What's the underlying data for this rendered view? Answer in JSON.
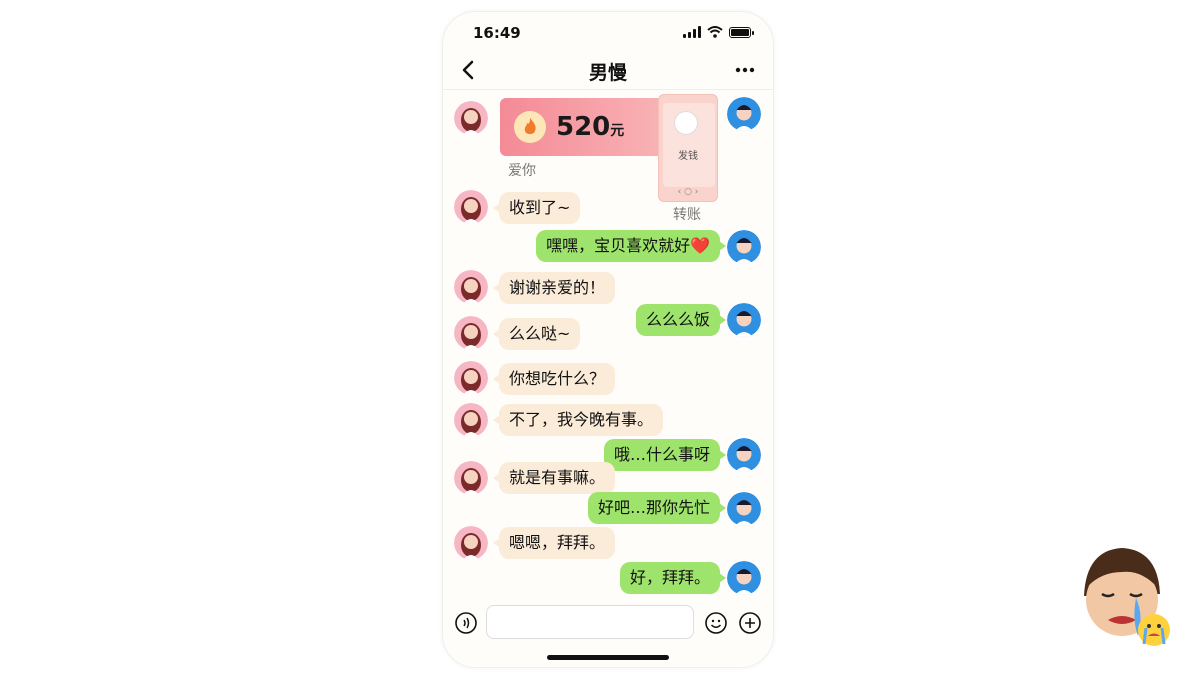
{
  "status_bar": {
    "time": "16:49"
  },
  "nav": {
    "title": "男慢"
  },
  "red_packet": {
    "amount": "520",
    "unit": "元",
    "caption": "爱你"
  },
  "transfer": {
    "label": "发钱",
    "caption": "转账"
  },
  "messages": [
    {
      "side": "left",
      "text": "收到了~"
    },
    {
      "side": "right",
      "text": "嘿嘿，宝贝喜欢就好❤️"
    },
    {
      "side": "left",
      "text": "谢谢亲爱的！"
    },
    {
      "side": "right",
      "text": "么么么饭"
    },
    {
      "side": "left",
      "text": "么么哒~"
    },
    {
      "side": "left",
      "text": "你想吃什么？"
    },
    {
      "side": "left",
      "text": "不了，我今晚有事。"
    },
    {
      "side": "right",
      "text": "哦…什么事呀"
    },
    {
      "side": "left",
      "text": "就是有事嘛。"
    },
    {
      "side": "right",
      "text": "好吧…那你先忙"
    },
    {
      "side": "left",
      "text": "嗯嗯，拜拜。"
    },
    {
      "side": "right",
      "text": "好，拜拜。"
    }
  ],
  "input": {
    "placeholder": ""
  },
  "icons": {
    "back": "back-icon",
    "more": "more-icon",
    "voice": "voice-icon",
    "emoji": "emoji-icon",
    "plus": "plus-icon",
    "sticker": "crying-face-sticker"
  },
  "colors": {
    "left_bubble": "#fbecd9",
    "right_bubble": "#9ee36b",
    "red_packet": "#f48a96"
  }
}
